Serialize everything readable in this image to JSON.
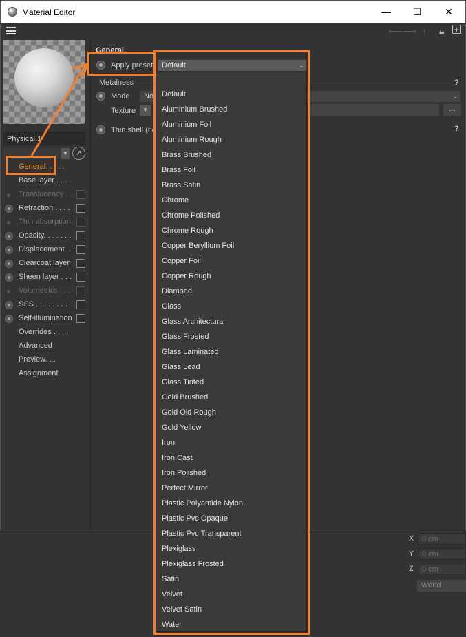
{
  "window": {
    "title": "Material Editor",
    "minimize": "—",
    "maximize": "☐",
    "close": "✕"
  },
  "material": {
    "name": "Physical.1"
  },
  "channels": [
    {
      "label": "General. . . . .",
      "state": "active",
      "marker": "none",
      "checkbox": false
    },
    {
      "label": "Base layer . . . .",
      "state": "normal",
      "marker": "none",
      "checkbox": false
    },
    {
      "label": "Translucency . .",
      "state": "dim",
      "marker": "dot",
      "checkbox": true
    },
    {
      "label": "Refraction . . . .",
      "state": "normal",
      "marker": "radio",
      "checkbox": true
    },
    {
      "label": "Thin absorption",
      "state": "dim",
      "marker": "dot",
      "checkbox": true
    },
    {
      "label": "Opacity. . . . . . .",
      "state": "normal",
      "marker": "radio",
      "checkbox": true
    },
    {
      "label": "Displacement. . .",
      "state": "normal",
      "marker": "radio",
      "checkbox": true
    },
    {
      "label": "Clearcoat layer",
      "state": "normal",
      "marker": "radio",
      "checkbox": true
    },
    {
      "label": "Sheen layer . . .",
      "state": "normal",
      "marker": "radio",
      "checkbox": true
    },
    {
      "label": "Volumetrics . . .",
      "state": "dim",
      "marker": "dot",
      "checkbox": true
    },
    {
      "label": "SSS  . . . . . . . .",
      "state": "normal",
      "marker": "radio",
      "checkbox": true
    },
    {
      "label": "Self-illumination",
      "state": "normal",
      "marker": "radio",
      "checkbox": true
    },
    {
      "label": "Overrides  . . . .",
      "state": "normal",
      "marker": "none",
      "checkbox": false
    },
    {
      "label": "Advanced",
      "state": "normal",
      "marker": "none",
      "checkbox": false
    },
    {
      "label": "Preview. . .",
      "state": "normal",
      "marker": "none",
      "checkbox": false
    },
    {
      "label": "Assignment",
      "state": "normal",
      "marker": "none",
      "checkbox": false
    }
  ],
  "general": {
    "section_title": "General",
    "apply_preset_label": "Apply preset",
    "preset_value": "Default",
    "metalness_group": "Metalness",
    "mode_label": "Mode",
    "mode_value": "No",
    "texture_label": "Texture",
    "thin_shell_label": "Thin shell (no",
    "help": "?",
    "ellipsis": "..."
  },
  "preset_options": [
    "Default",
    "Aluminium Brushed",
    "Aluminium Foil",
    "Aluminium Rough",
    "Brass Brushed",
    "Brass Foil",
    "Brass Satin",
    "Chrome",
    "Chrome Polished",
    "Chrome Rough",
    "Copper Beryllium Foil",
    "Copper Foil",
    "Copper Rough",
    "Diamond",
    "Glass",
    "Glass Architectural",
    "Glass Frosted",
    "Glass Laminated",
    "Glass Lead",
    "Glass Tinted",
    "Gold Brushed",
    "Gold Old Rough",
    "Gold Yellow",
    "Iron",
    "Iron Cast",
    "Iron Polished",
    "Perfect Mirror",
    "Plastic Polyamide Nylon",
    "Plastic Pvc Opaque",
    "Plastic Pvc Transparent",
    "Plexiglass",
    "Plexiglass Frosted",
    "Satin",
    "Velvet",
    "Velvet Satin",
    "Water"
  ],
  "coords": {
    "x_label": "X",
    "y_label": "Y",
    "z_label": "Z",
    "x_value": "0 cm",
    "y_value": "0 cm",
    "z_value": "0 cm",
    "space": "World"
  },
  "colors": {
    "highlight": "#f47e2a",
    "active_channel": "#f08a24"
  }
}
